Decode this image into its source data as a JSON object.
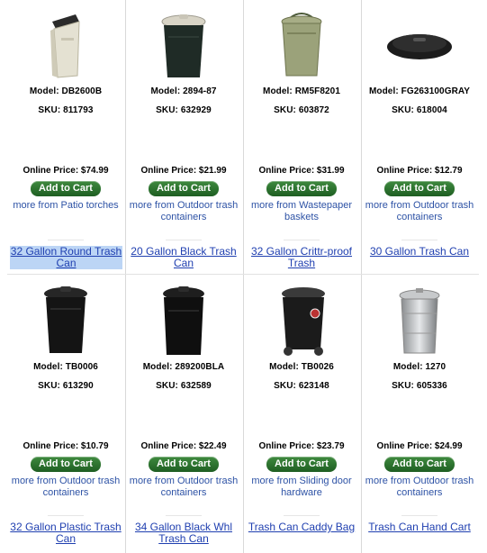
{
  "products": [
    {
      "model": "Model: DB2600B",
      "sku": "SKU: 811793",
      "price": "Online Price: $74.99",
      "cart": "Add to Cart",
      "more": "more from Patio torches",
      "title": "32 Gallon Round Trash Can",
      "icon": "slim-trash-can-icon"
    },
    {
      "model": "Model: 2894-87",
      "sku": "SKU: 632929",
      "price": "Online Price: $21.99",
      "cart": "Add to Cart",
      "more": "more from Outdoor trash containers",
      "title": "20 Gallon Black Trash Can",
      "icon": "black-trash-can-icon"
    },
    {
      "model": "Model: RM5F8201",
      "sku": "SKU: 603872",
      "price": "Online Price: $31.99",
      "cart": "Add to Cart",
      "more": "more from Wastepaper baskets",
      "title": "32 Gallon Crittr-proof Trash",
      "icon": "green-trash-can-icon"
    },
    {
      "model": "Model: FG263100GRAY",
      "sku": "SKU: 618004",
      "price": "Online Price: $12.79",
      "cart": "Add to Cart",
      "more": "more from Outdoor trash containers",
      "title": "30 Gallon Trash Can",
      "icon": "trash-can-lid-icon"
    },
    {
      "model": "Model: TB0006",
      "sku": "SKU: 613290",
      "price": "Online Price: $10.79",
      "cart": "Add to Cart",
      "more": "more from Outdoor trash containers",
      "title": "32 Gallon Plastic Trash Can",
      "icon": "black-trash-can-icon"
    },
    {
      "model": "Model: 289200BLA",
      "sku": "SKU: 632589",
      "price": "Online Price: $22.49",
      "cart": "Add to Cart",
      "more": "more from Outdoor trash containers",
      "title": "34 Gallon Black Whl Trash Can",
      "icon": "black-trash-can-icon"
    },
    {
      "model": "Model: TB0026",
      "sku": "SKU: 623148",
      "price": "Online Price: $23.79",
      "cart": "Add to Cart",
      "more": "more from Sliding door hardware",
      "title": "Trash Can Caddy Bag",
      "icon": "wheeled-trash-can-icon"
    },
    {
      "model": "Model: 1270",
      "sku": "SKU: 605336",
      "price": "Online Price: $24.99",
      "cart": "Add to Cart",
      "more": "more from Outdoor trash containers",
      "title": "Trash Can Hand Cart",
      "icon": "metal-trash-can-icon"
    }
  ]
}
